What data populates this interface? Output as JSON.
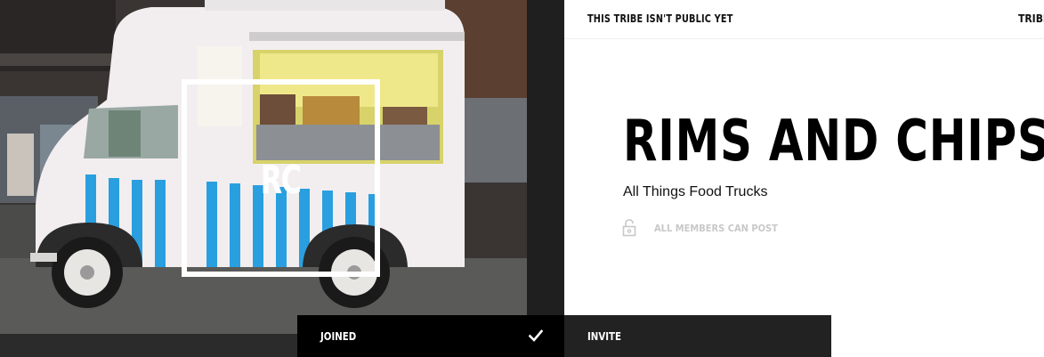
{
  "cover": {
    "logo_initials": "RC"
  },
  "header": {
    "privacy_note": "THIS TRIBE ISN'T PUBLIC YET",
    "nav_label": "TRIBE"
  },
  "tribe": {
    "title": "RIMS AND CHIPS_",
    "subtitle": "All Things Food Trucks",
    "posting_permission": "ALL MEMBERS CAN POST"
  },
  "actions": {
    "joined_label": "JOINED",
    "invite_label": "INVITE"
  },
  "colors": {
    "photo_bg": "#2b2b2b",
    "truck_body": "#f2eef0",
    "stripe_blue": "#2a9fe0",
    "joined_bg": "#000000",
    "invite_bg": "#222222",
    "muted_text": "#c8c8c8"
  },
  "icons": {
    "lock": "unlock-icon",
    "check": "check-icon"
  }
}
